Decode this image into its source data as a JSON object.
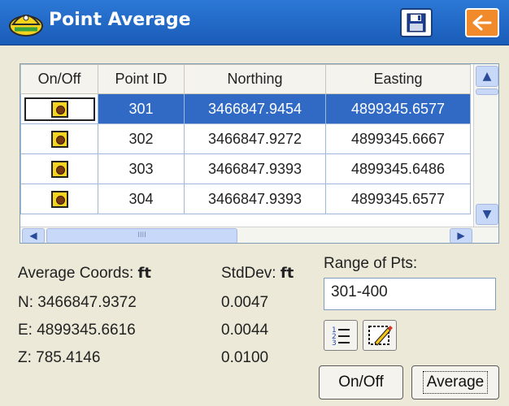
{
  "window": {
    "title": "Point Average"
  },
  "grid": {
    "columns": [
      "On/Off",
      "Point ID",
      "Northing",
      "Easting"
    ],
    "rows": [
      {
        "id": "301",
        "northing": "3466847.9454",
        "easting": "4899345.6577",
        "selected": true
      },
      {
        "id": "302",
        "northing": "3466847.9272",
        "easting": "4899345.6667",
        "selected": false
      },
      {
        "id": "303",
        "northing": "3466847.9393",
        "easting": "4899345.6486",
        "selected": false
      },
      {
        "id": "304",
        "northing": "3466847.9393",
        "easting": "4899345.6577",
        "selected": false
      }
    ],
    "hscroll_grip": "IIII"
  },
  "average": {
    "label": "Average Coords:",
    "unit": "ft",
    "n": "N: 3466847.9372",
    "e": "E: 4899345.6616",
    "z": "Z: 785.4146"
  },
  "stddev": {
    "label": "StdDev:",
    "unit": "ft",
    "n": "0.0047",
    "e": "0.0044",
    "z": "0.0100"
  },
  "range": {
    "label": "Range of Pts:",
    "value": "301-400"
  },
  "buttons": {
    "onoff": "On/Off",
    "average": "Average"
  },
  "icons": {
    "app": "hard-hat-icon",
    "save": "floppy-disk-icon",
    "back": "arrow-left-icon",
    "list": "numbered-list-icon",
    "edit": "edit-pencil-icon"
  },
  "colors": {
    "titlebar": "#1a5cb8",
    "selection": "#316ac5",
    "back_button": "#f08a2a",
    "pane": "#ece9d8"
  }
}
